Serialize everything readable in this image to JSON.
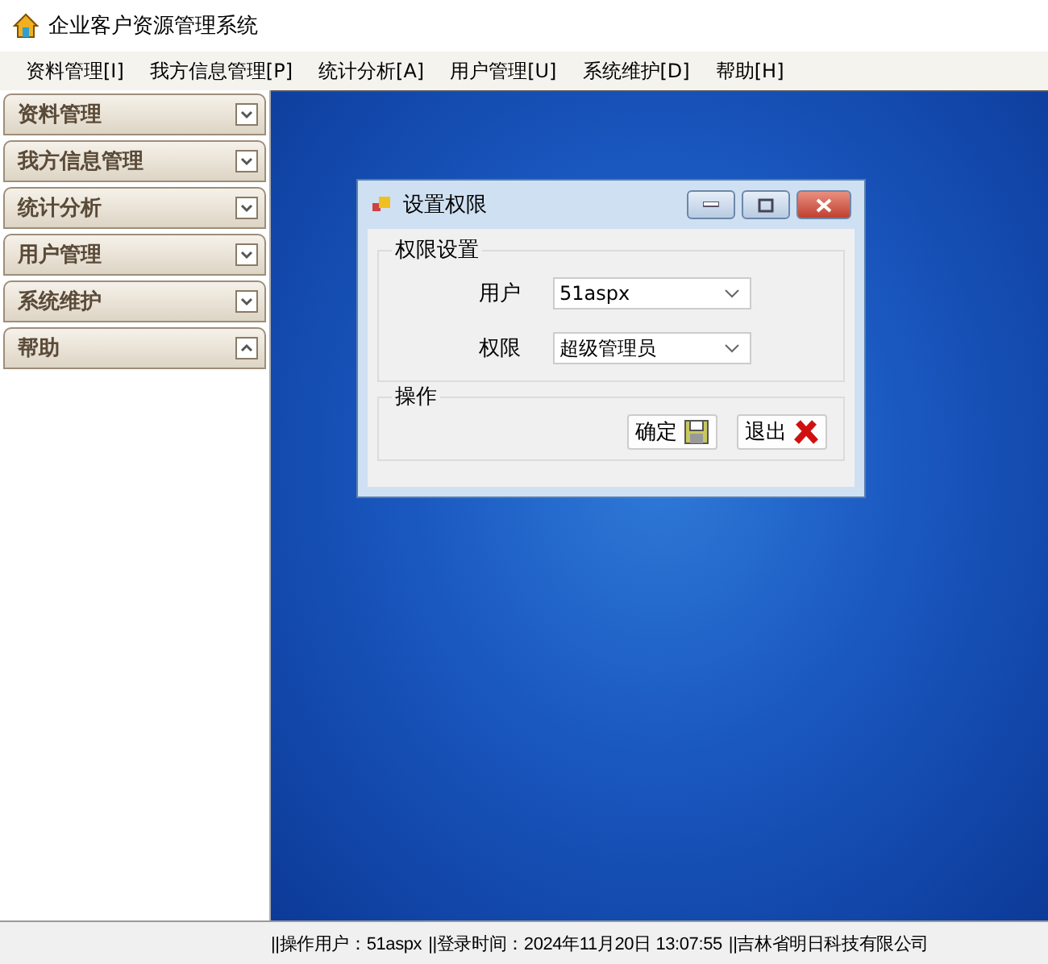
{
  "window": {
    "title": "企业客户资源管理系统"
  },
  "menu": [
    "资料管理[I]",
    "我方信息管理[P]",
    "统计分析[A]",
    "用户管理[U]",
    "系统维护[D]",
    "帮助[H]"
  ],
  "sidebar": {
    "items": [
      {
        "label": "资料管理",
        "expanded": false
      },
      {
        "label": "我方信息管理",
        "expanded": false
      },
      {
        "label": "统计分析",
        "expanded": false
      },
      {
        "label": "用户管理",
        "expanded": false
      },
      {
        "label": "系统维护",
        "expanded": false
      },
      {
        "label": "帮助",
        "expanded": true
      }
    ]
  },
  "dialog": {
    "title": "设置权限",
    "groups": [
      {
        "title": "权限设置",
        "fields": [
          {
            "label": "用户",
            "value": "51aspx"
          },
          {
            "label": "权限",
            "value": "超级管理员"
          }
        ]
      },
      {
        "title": "操作",
        "buttons": [
          {
            "label": "确定",
            "kind": "save"
          },
          {
            "label": "退出",
            "kind": "exit"
          }
        ]
      }
    ]
  },
  "status_bar": [
    "||操作用户：51aspx",
    "||登录时间：2024年11月20日 13:07:55",
    "||吉林省明日科技有限公司"
  ]
}
